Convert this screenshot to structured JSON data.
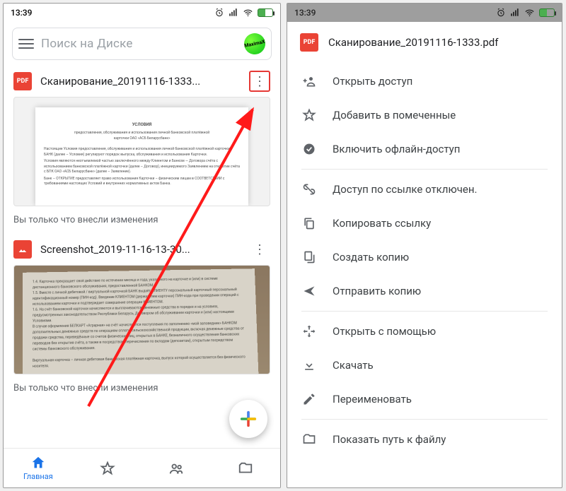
{
  "statusbar": {
    "time": "13:39"
  },
  "search": {
    "placeholder": "Поиск на Диске",
    "avatar_text": "MaximaX"
  },
  "files": [
    {
      "type_label": "PDF",
      "name": "Сканирование_20191116-1333...",
      "caption": "Вы только что внесли изменения"
    },
    {
      "type_label": "",
      "name": "Screenshot_2019-11-16-13-30...",
      "caption": "Вы только что внесли изменения"
    }
  ],
  "bottomnav": {
    "home": "Главная"
  },
  "sheet": {
    "filename": "Сканирование_20191116-1333.pdf",
    "items": {
      "share": "Открыть доступ",
      "star": "Добавить в помеченные",
      "offline": "Включить офлайн-доступ",
      "link_off": "Доступ по ссылке отключен.",
      "copy_link": "Копировать ссылку",
      "make_copy": "Создать копию",
      "send_copy": "Отправить копию",
      "open_with": "Открыть с помощью",
      "download": "Скачать",
      "rename": "Переименовать",
      "show_path": "Показать путь к файлу"
    }
  }
}
